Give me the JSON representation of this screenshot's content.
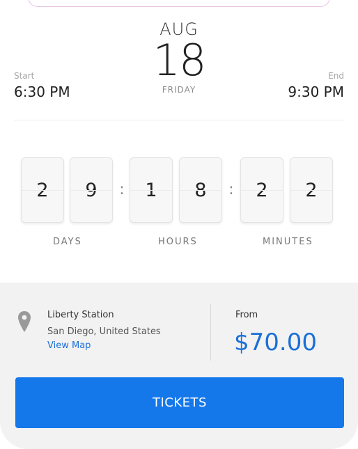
{
  "event_date": {
    "month": "AUG",
    "day": "18",
    "weekday": "FRIDAY"
  },
  "times": {
    "start_label": "Start",
    "start_value": "6:30 PM",
    "end_label": "End",
    "end_value": "9:30 PM"
  },
  "countdown": {
    "days_digits": [
      "2",
      "9"
    ],
    "hours_digits": [
      "1",
      "8"
    ],
    "minutes_digits": [
      "2",
      "2"
    ],
    "separator": ":",
    "labels": {
      "days": "DAYS",
      "hours": "HOURS",
      "minutes": "MINUTES"
    }
  },
  "venue": {
    "name": "Liberty Station",
    "city": "San Diego, United States",
    "map_link": "View Map"
  },
  "pricing": {
    "label": "From",
    "value": "$70.00"
  },
  "actions": {
    "tickets_label": "TICKETS"
  },
  "colors": {
    "accent": "#1478eb",
    "link": "#1a6fd8",
    "panel": "#f2f2f2"
  },
  "icons": {
    "location": "map-pin-icon"
  }
}
